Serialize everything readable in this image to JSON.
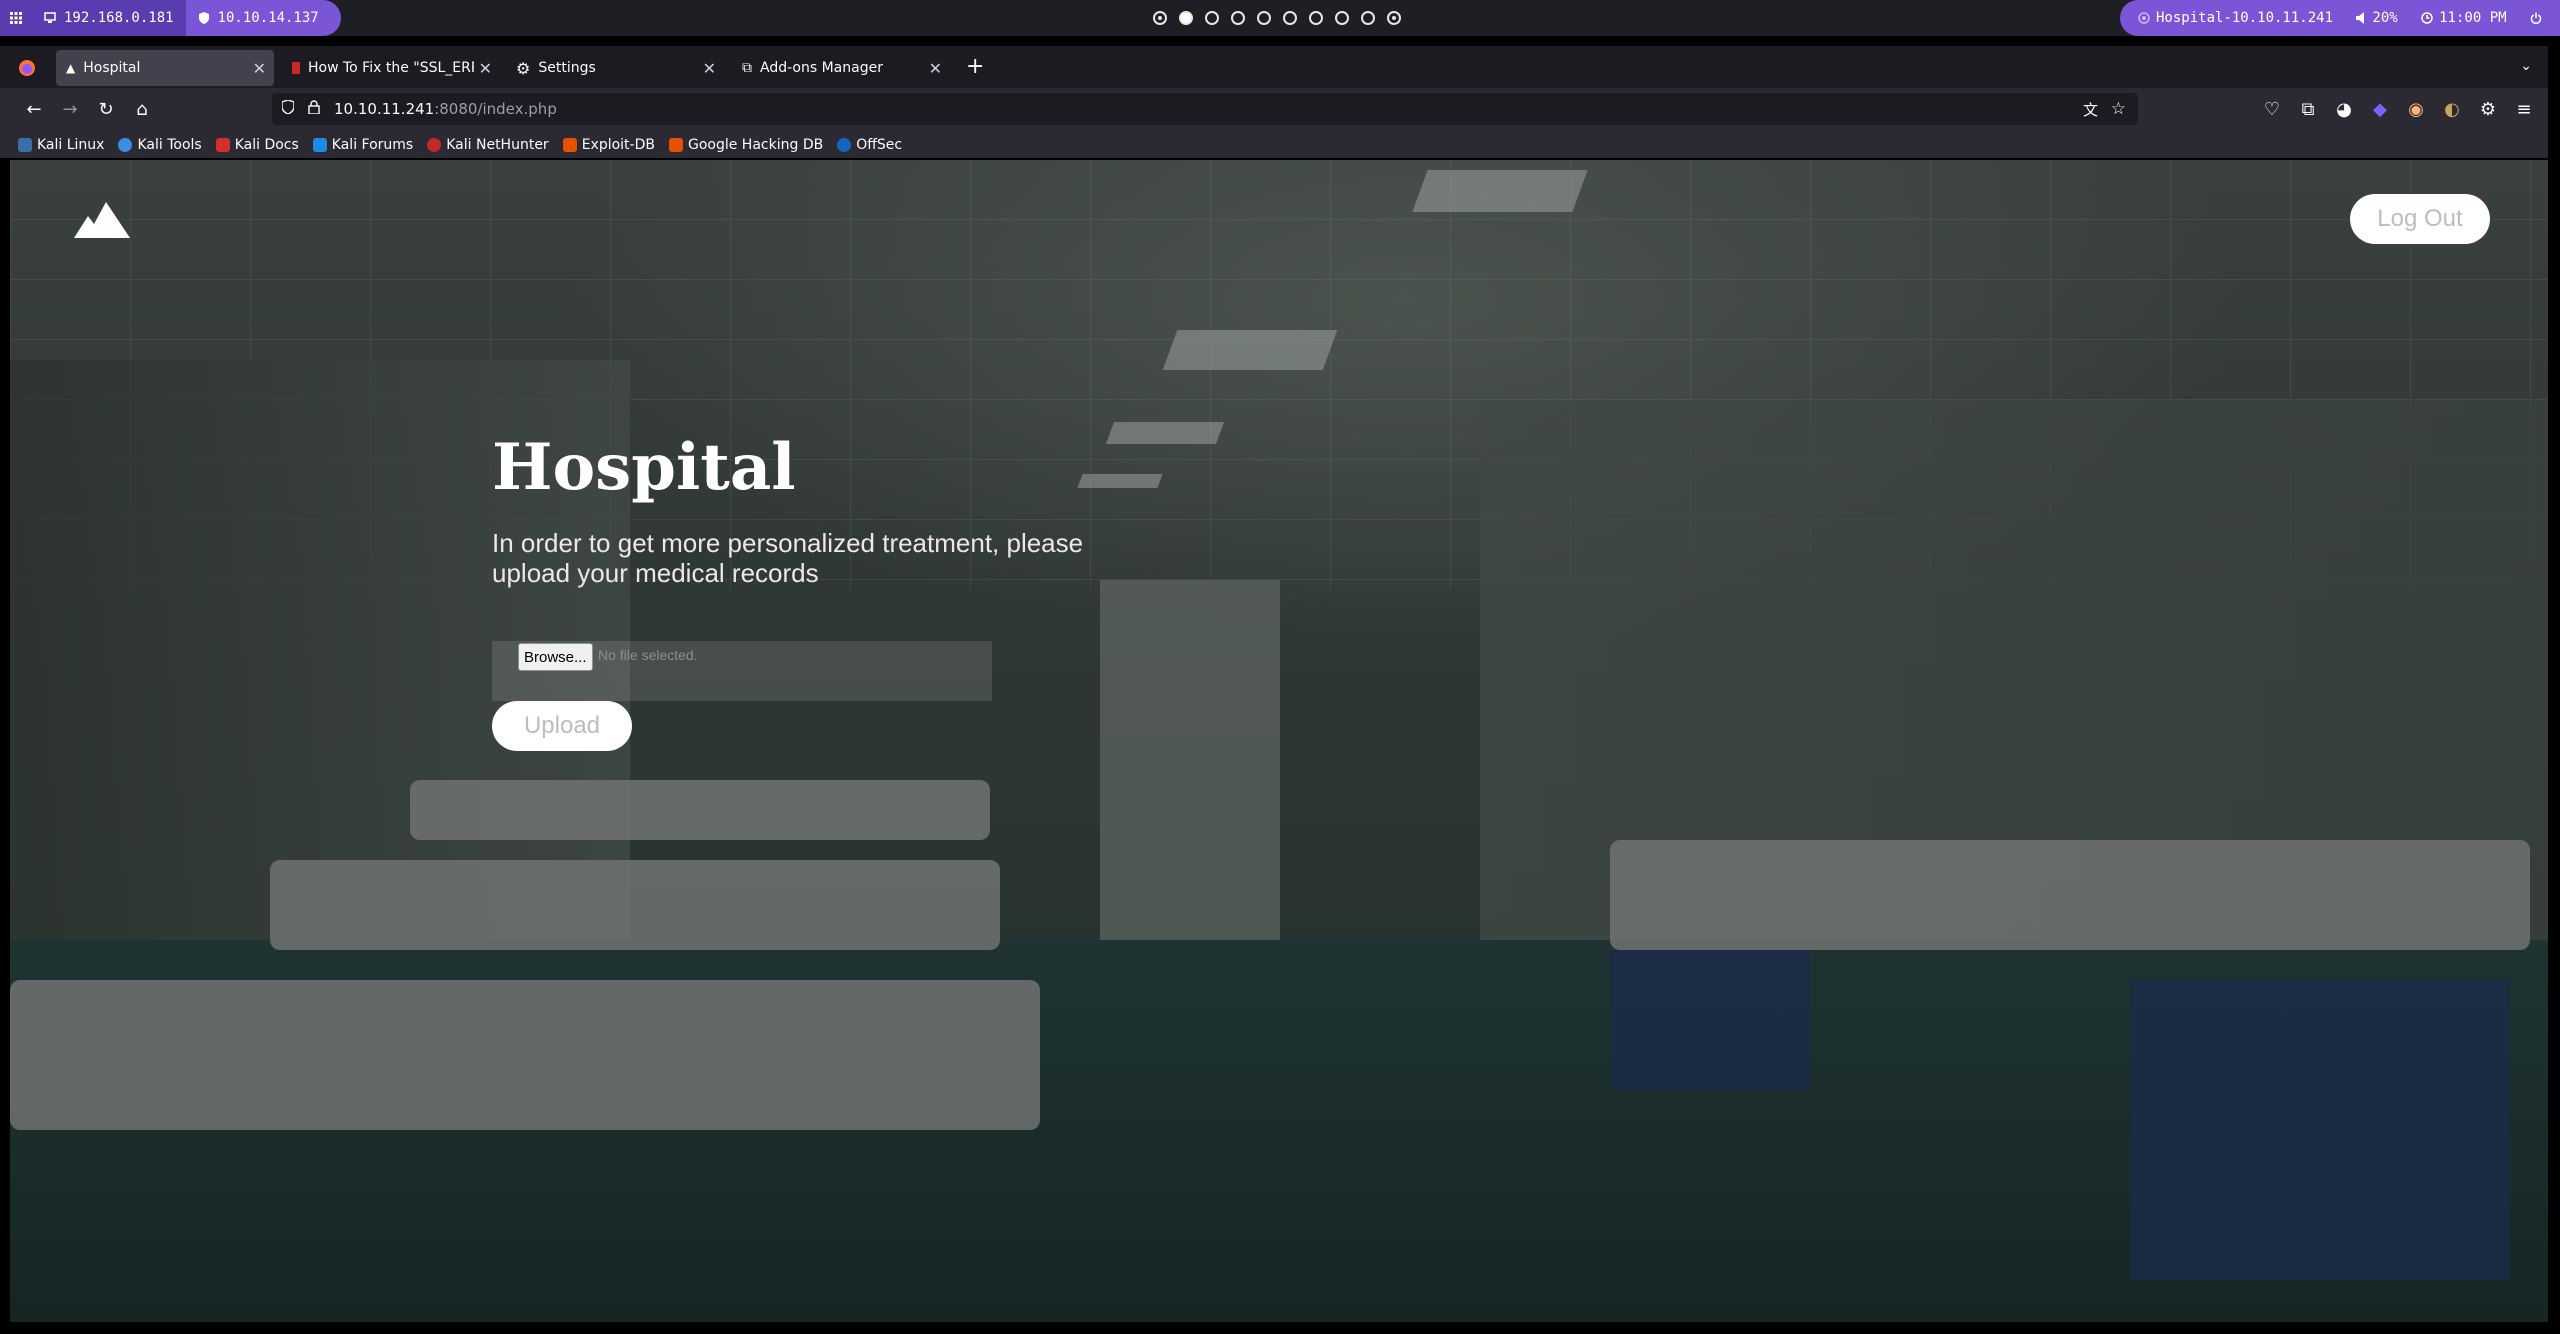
{
  "system_panel": {
    "ip_local": "192.168.0.181",
    "ip_vpn": "10.10.14.137",
    "workspace_count": 10,
    "active_workspace": 2,
    "target": "Hospital-10.10.11.241",
    "volume": "20%",
    "clock": "11:00 PM"
  },
  "tabs": [
    {
      "label": "Hospital",
      "active": true
    },
    {
      "label": "How To Fix the \"SSL_ERROR",
      "active": false
    },
    {
      "label": "Settings",
      "active": false
    },
    {
      "label": "Add-ons Manager",
      "active": false
    }
  ],
  "url": {
    "host": "10.10.11.241",
    "path": ":8080/index.php"
  },
  "bookmarks": [
    {
      "label": "Kali Linux",
      "color": "#3b6ea8"
    },
    {
      "label": "Kali Tools",
      "color": "#3b8de0"
    },
    {
      "label": "Kali Docs",
      "color": "#d32f2f"
    },
    {
      "label": "Kali Forums",
      "color": "#1e88e5"
    },
    {
      "label": "Kali NetHunter",
      "color": "#c62828"
    },
    {
      "label": "Exploit-DB",
      "color": "#e65100"
    },
    {
      "label": "Google Hacking DB",
      "color": "#e65100"
    },
    {
      "label": "OffSec",
      "color": "#1565c0"
    }
  ],
  "page": {
    "logout_label": "Log Out",
    "title": "Hospital",
    "subtitle": "In order to get more personalized treatment, please upload your medical records",
    "browse_label": "Browse...",
    "file_status": "No file selected.",
    "upload_label": "Upload"
  },
  "colors": {
    "panel_accent": "#7a55d6",
    "panel_dark": "#5b3cb0",
    "browser_bg": "#2b2a33"
  }
}
